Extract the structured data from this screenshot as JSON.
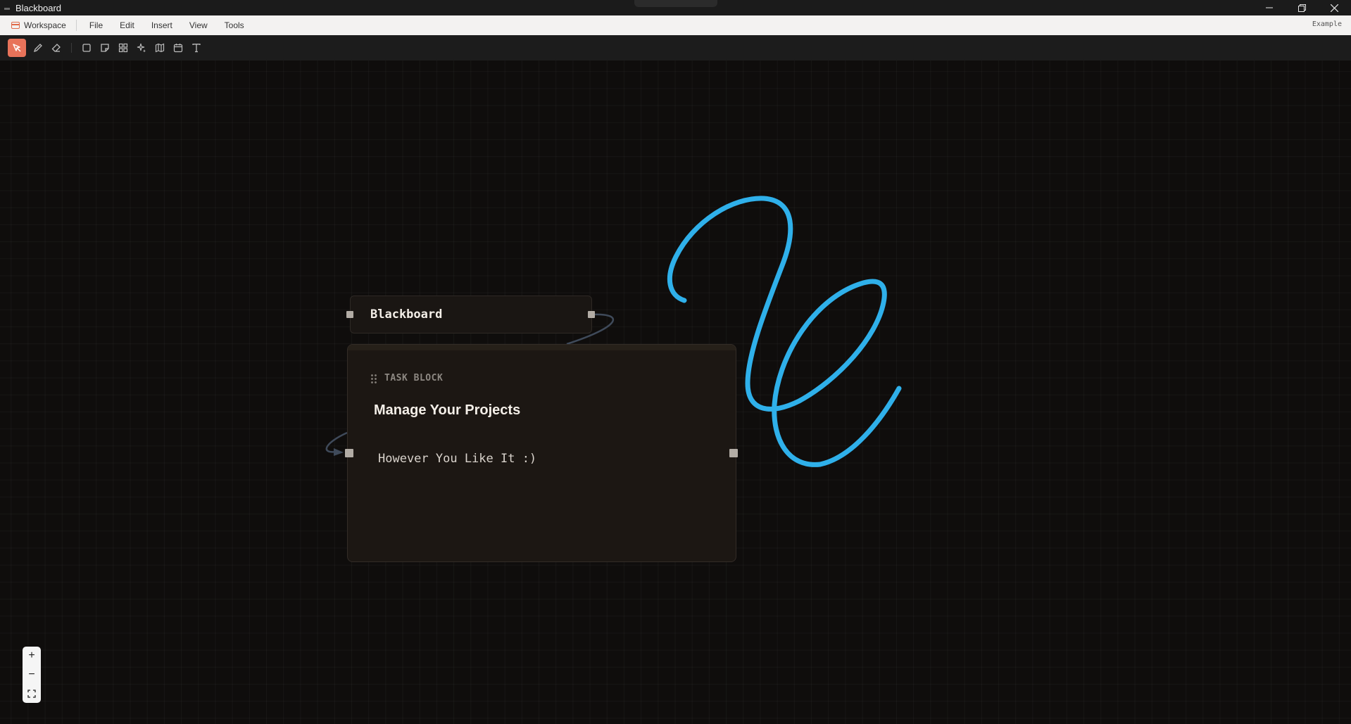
{
  "window": {
    "title": "Blackboard"
  },
  "menubar": {
    "workspace_label": "Workspace",
    "items": [
      "File",
      "Edit",
      "Insert",
      "View",
      "Tools"
    ],
    "right_label": "Example"
  },
  "toolbar": {
    "tools": [
      {
        "name": "select-tool",
        "icon": "cursor-icon",
        "active": true
      },
      {
        "name": "pen-tool",
        "icon": "pencil-icon",
        "active": false
      },
      {
        "name": "eraser-tool",
        "icon": "eraser-icon",
        "active": false
      },
      {
        "name": "rectangle-tool",
        "icon": "square-icon",
        "active": false
      },
      {
        "name": "note-tool",
        "icon": "sticky-note-icon",
        "active": false
      },
      {
        "name": "grid-tool",
        "icon": "grid-icon",
        "active": false
      },
      {
        "name": "sparkle-tool",
        "icon": "sparkles-icon",
        "active": false
      },
      {
        "name": "map-tool",
        "icon": "map-icon",
        "active": false
      },
      {
        "name": "calendar-tool",
        "icon": "calendar-icon",
        "active": false
      },
      {
        "name": "text-tool",
        "icon": "text-icon",
        "active": false
      }
    ],
    "accent_color": "#e8735a"
  },
  "canvas": {
    "title_node": {
      "text": "Blackboard"
    },
    "task_node": {
      "label": "TASK BLOCK",
      "title": "Manage Your Projects",
      "description": "However You Like It :)"
    },
    "drawing_color": "#2fb0ea"
  },
  "zoom_controls": {
    "zoom_in": "+",
    "zoom_out": "−"
  }
}
